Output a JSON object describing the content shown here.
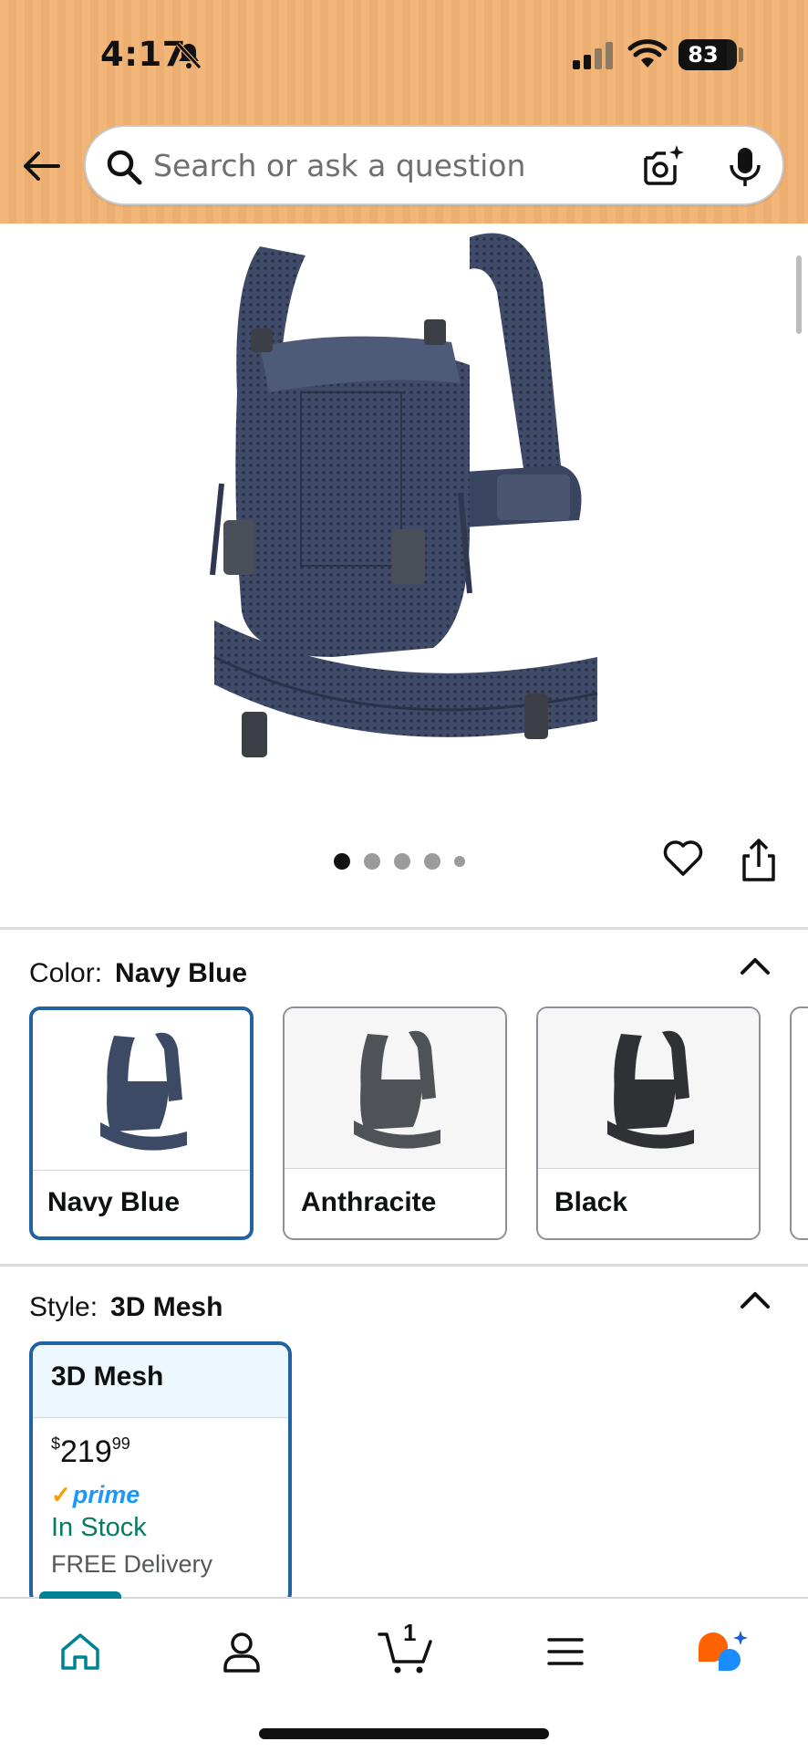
{
  "status_bar": {
    "time": "4:17",
    "battery": "83",
    "battery_level": 0.83,
    "icons": [
      "bell-slash-icon",
      "cellular-signal-icon",
      "wifi-icon",
      "battery-icon"
    ]
  },
  "header": {
    "search_placeholder": "Search or ask a question",
    "icons": [
      "back-arrow-icon",
      "search-icon",
      "camera-icon",
      "microphone-icon"
    ],
    "background_color": "#f2b679"
  },
  "gallery": {
    "image_count": 5,
    "active_index": 0,
    "icons": [
      "heart-icon",
      "share-icon"
    ]
  },
  "color": {
    "label": "Color:",
    "selected": "Navy Blue",
    "options": [
      {
        "name": "Navy Blue",
        "shade": "#3d4a66"
      },
      {
        "name": "Anthracite",
        "shade": "#4f5357"
      },
      {
        "name": "Black",
        "shade": "#2f3134"
      }
    ]
  },
  "style": {
    "label": "Style:",
    "selected": "3D Mesh",
    "card": {
      "title": "3D Mesh",
      "currency": "$",
      "price_whole": "219",
      "price_fraction": "99",
      "prime": "prime",
      "stock": "In Stock",
      "delivery": "FREE Delivery"
    }
  },
  "bottom_nav": {
    "cart_count": "1",
    "items": [
      "home-icon",
      "account-icon",
      "cart-icon",
      "menu-icon",
      "rufus-assistant-icon"
    ],
    "accent_color": "#008296"
  },
  "colors": {
    "selected_border": "#2162a1",
    "in_stock": "#067d62",
    "prime": "#1a98ff"
  }
}
